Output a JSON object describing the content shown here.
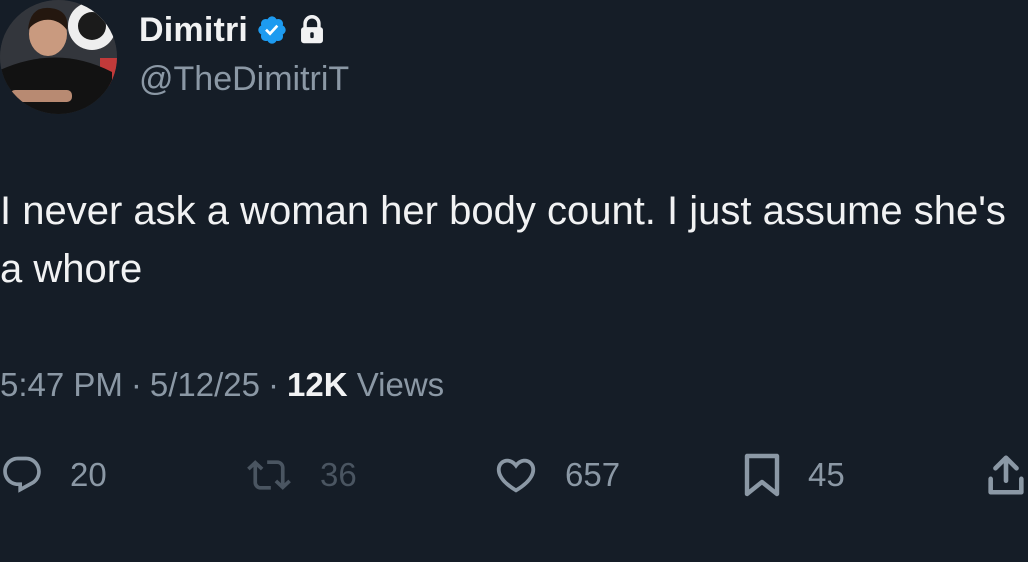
{
  "user": {
    "display_name": "Dimitri",
    "handle": "@TheDimitriT",
    "verified_icon": "verified-badge-icon",
    "lock_icon": "lock-icon",
    "verified_color": "#1d9bf0"
  },
  "tweet": {
    "text": "I never ask a woman her body count. I just assume she's a whore"
  },
  "meta": {
    "time": "5:47 PM",
    "separator": "·",
    "date": "5/12/25",
    "views_count": "12K",
    "views_label": "Views"
  },
  "actions": {
    "reply": {
      "icon": "reply-icon",
      "count": "20"
    },
    "retweet": {
      "icon": "retweet-icon",
      "count": "36"
    },
    "like": {
      "icon": "heart-icon",
      "count": "657"
    },
    "bookmark": {
      "icon": "bookmark-icon",
      "count": "45"
    },
    "share": {
      "icon": "share-icon"
    }
  },
  "colors": {
    "background": "#151d27",
    "primary_text": "#f1f2f3",
    "secondary_text": "#8b98a5",
    "muted": "#4a5561"
  }
}
